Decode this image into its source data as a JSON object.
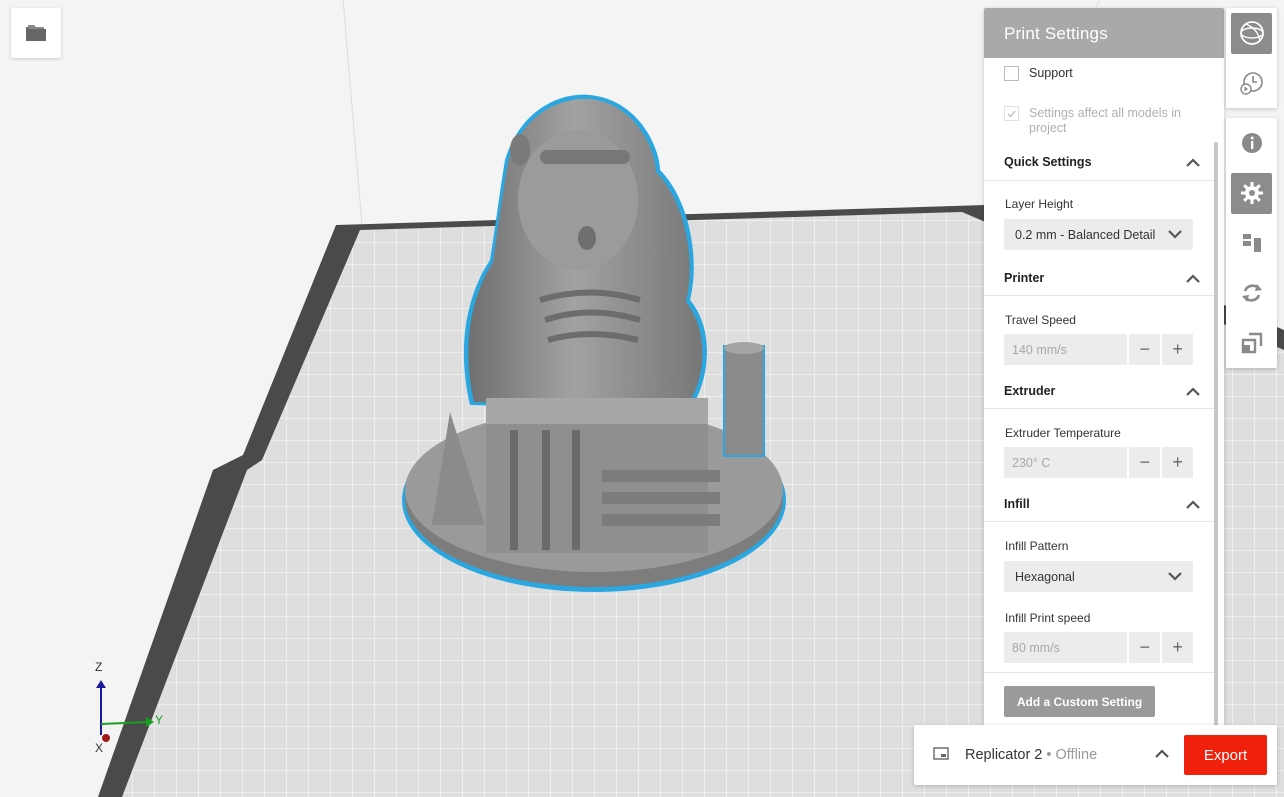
{
  "axes": {
    "z": "Z",
    "y": "Y",
    "x": "X"
  },
  "panel": {
    "title": "Print Settings",
    "support_label": "Support",
    "affect_all_label": "Settings affect all models in project",
    "sections": {
      "quick": {
        "title": "Quick Settings",
        "layer_height_label": "Layer Height",
        "layer_height_value": "0.2 mm - Balanced Detail"
      },
      "printer": {
        "title": "Printer",
        "travel_speed_label": "Travel Speed",
        "travel_speed_value": "140 mm/s"
      },
      "extruder": {
        "title": "Extruder",
        "temp_label": "Extruder Temperature",
        "temp_value": "230° C"
      },
      "infill": {
        "title": "Infill",
        "pattern_label": "Infill Pattern",
        "pattern_value": "Hexagonal",
        "speed_label": "Infill Print speed",
        "speed_value": "80 mm/s"
      }
    },
    "add_custom_label": "Add a Custom Setting"
  },
  "toolbar": {
    "icons": [
      "view-icon",
      "print-preview-icon",
      "info-icon",
      "settings-gear-icon",
      "arrange-icon",
      "rotate-icon",
      "scale-icon"
    ]
  },
  "bottombar": {
    "printer_name": "Replicator 2",
    "printer_status": " • Offline",
    "export_label": "Export"
  },
  "colors": {
    "accent": "#f0210c",
    "selection_outline": "#2aa7e0",
    "model_gray": "#8d8d8d",
    "header_gray": "#a9a9a9"
  }
}
